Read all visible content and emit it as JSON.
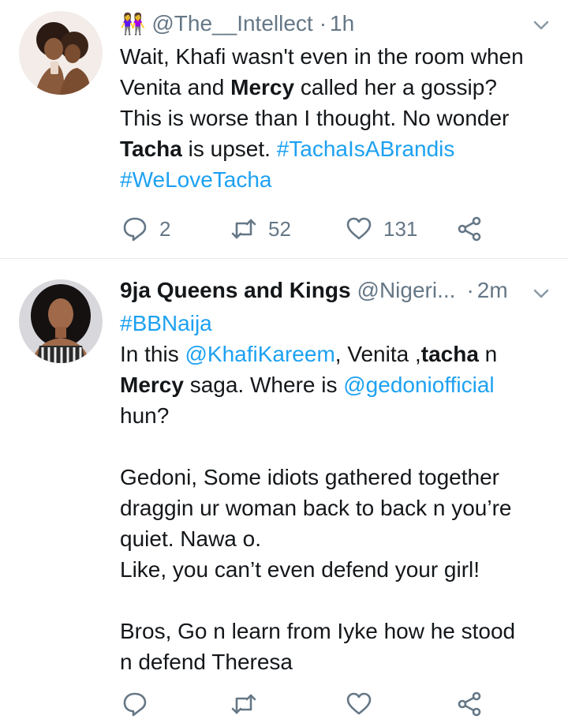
{
  "tweets": [
    {
      "emoji": "👭",
      "handle": "@The__Intellect",
      "sep": "·",
      "time": "1h",
      "body": [
        {
          "t": "Wait, Khafi wasn't even in the room when\nVenita and "
        },
        {
          "t": "Mercy",
          "b": true
        },
        {
          "t": " called her a gossip?\nThis is worse than I thought. No wonder\n"
        },
        {
          "t": "Tacha",
          "b": true
        },
        {
          "t": " is upset. "
        },
        {
          "t": "#TachaIsABrandis",
          "link": true
        },
        {
          "t": "\n"
        },
        {
          "t": "#WeLoveTacha",
          "link": true
        }
      ],
      "replies": "2",
      "retweets": "52",
      "likes": "131"
    },
    {
      "name": "9ja Queens and Kings",
      "handle": "@Nigeri...",
      "sep": "·",
      "time": "2m",
      "body": [
        {
          "t": "#BBNaija",
          "link": true
        },
        {
          "t": "\nIn this "
        },
        {
          "t": "@KhafiKareem",
          "link": true
        },
        {
          "t": ", Venita ,"
        },
        {
          "t": "tacha",
          "b": true
        },
        {
          "t": " n\n"
        },
        {
          "t": "Mercy",
          "b": true
        },
        {
          "t": " saga. Where is "
        },
        {
          "t": "@gedoniofficial",
          "link": true
        },
        {
          "t": "\nhun?\n\nGedoni, Some idiots gathered together\ndraggin ur woman back to back n you’re\nquiet. Nawa o.\nLike, you can’t even defend your girl!\n\nBros, Go n learn from Iyke how he stood\nn defend Theresa"
        }
      ],
      "replies": "",
      "retweets": "",
      "likes": ""
    }
  ],
  "colors": {
    "text": "#14171a",
    "secondary": "#657786",
    "link": "#1da1f2",
    "divider": "#e1e8ed"
  }
}
